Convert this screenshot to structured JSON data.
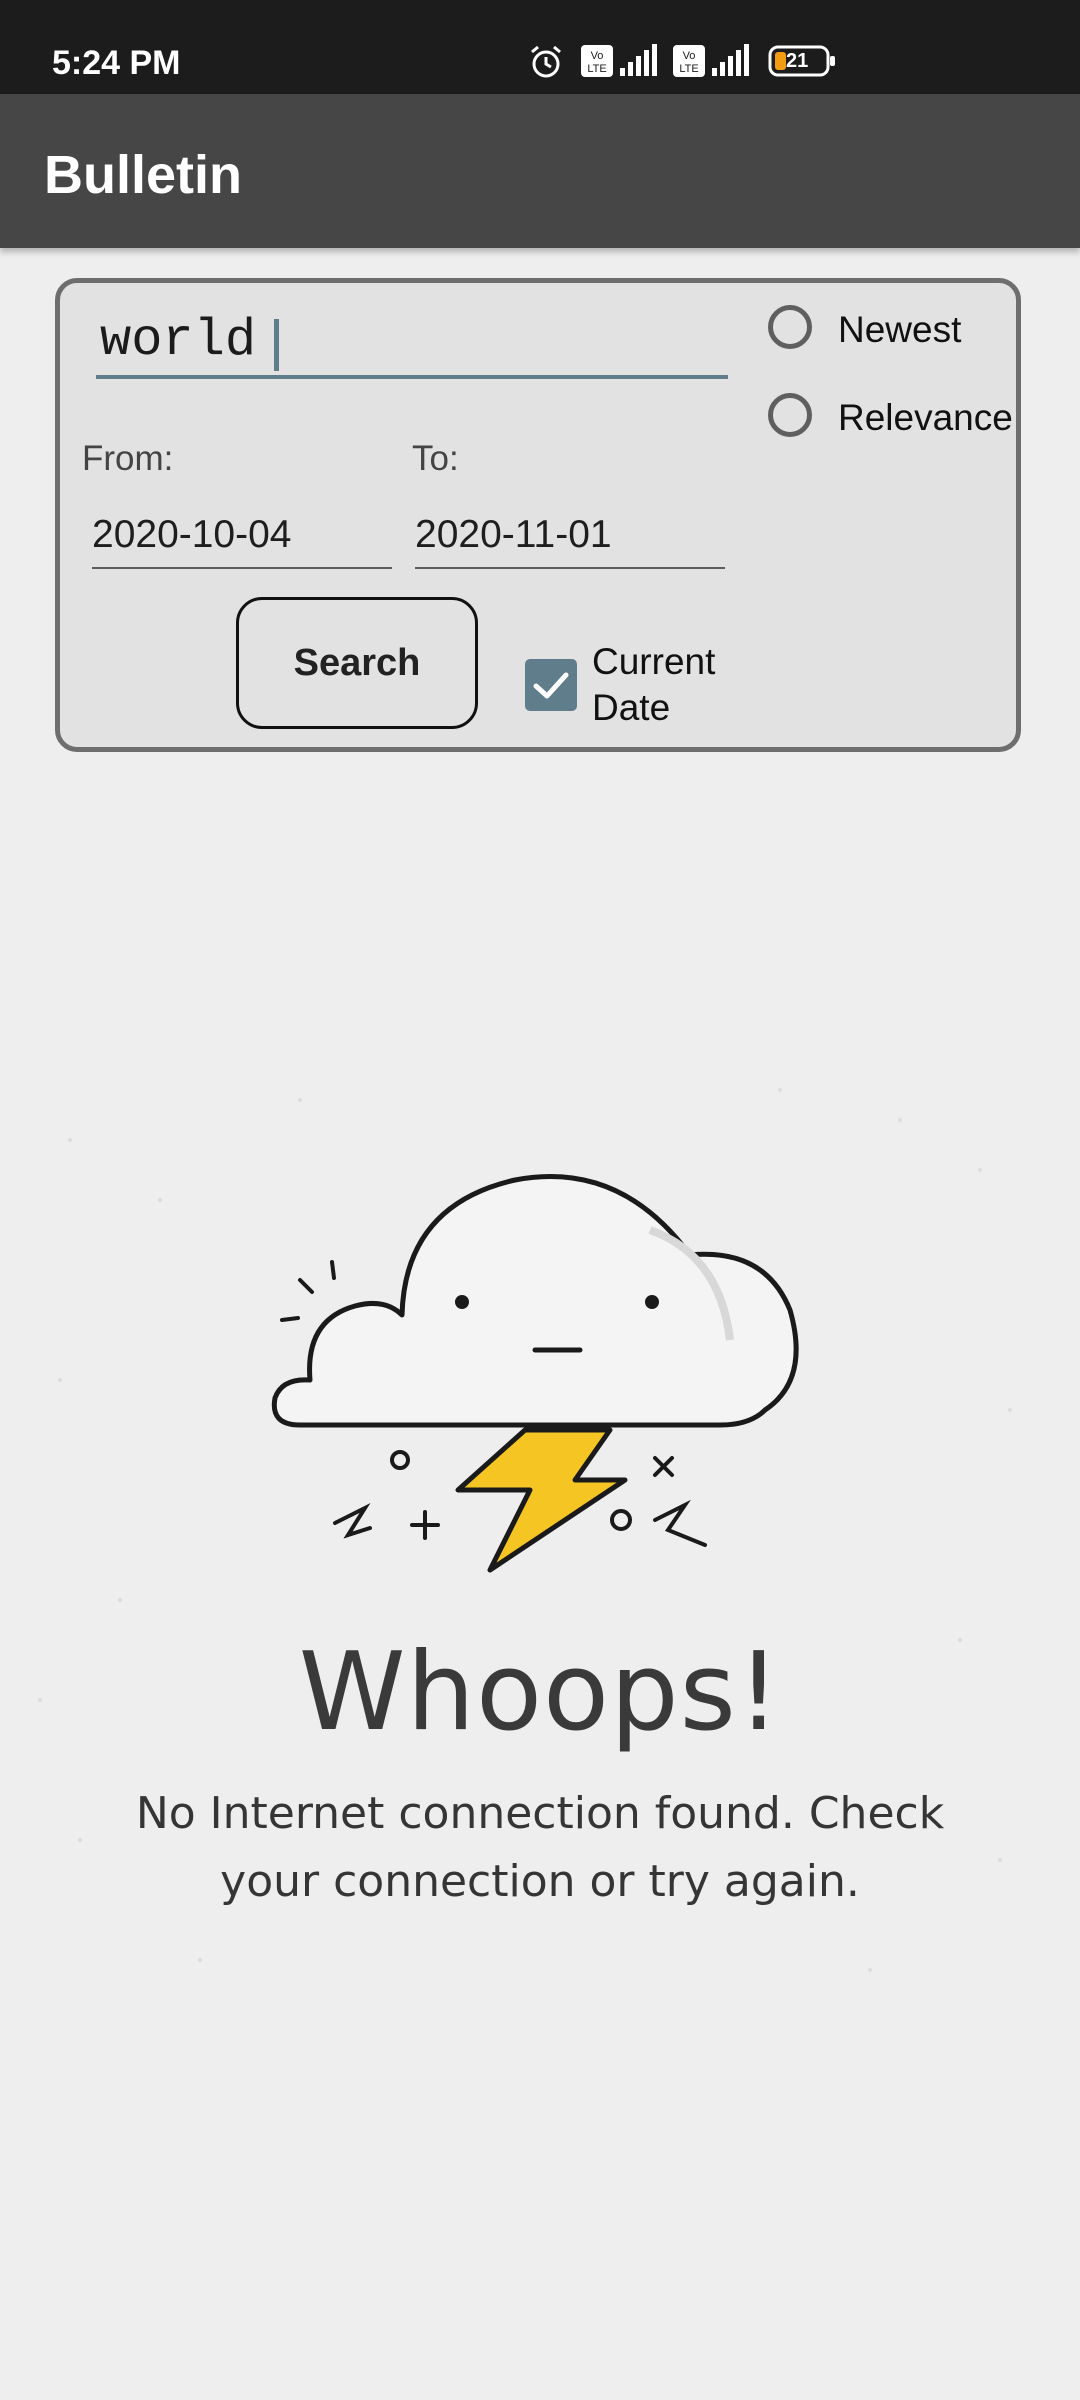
{
  "status_bar": {
    "time": "5:24 PM",
    "battery": "21",
    "icons": [
      "alarm-icon",
      "volte-icon",
      "signal-icon",
      "volte-icon",
      "signal-icon",
      "battery-icon"
    ]
  },
  "app_bar": {
    "title": "Bulletin"
  },
  "search": {
    "query_value": "world",
    "sort_options": [
      {
        "label": "Newest",
        "selected": false
      },
      {
        "label": "Relevance",
        "selected": false
      }
    ],
    "from_label": "From:",
    "from_value": "2020-10-04",
    "to_label": "To:",
    "to_value": "2020-11-01",
    "search_button": "Search",
    "current_date_label": "Current Date",
    "current_date_checked": true
  },
  "error": {
    "title": "Whoops!",
    "message": "No Internet connection found. Check your connection or try again."
  },
  "colors": {
    "accent": "#607d8b",
    "app_bar": "#464646",
    "status_bar": "#1c1c1c",
    "lightning": "#f5c623"
  }
}
